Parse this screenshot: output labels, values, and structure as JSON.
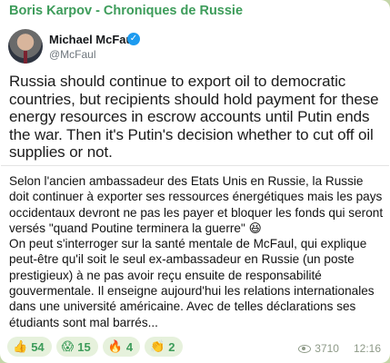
{
  "channel": {
    "name": "Boris Karpov - Chroniques de Russie"
  },
  "tweet": {
    "author": "Michael McFaul",
    "handle": "@McFaul",
    "text": "Russia should continue to export oil to democratic countries, but recipients should hold payment for these energy resources in escrow accounts until Putin ends the war. Then it's Putin's decision whether to cut off oil supplies or not."
  },
  "post": {
    "paragraph1": "Selon l'ancien ambassadeur des Etats Unis en Russie, la Russie doit continuer à exporter ses ressources énergétiques mais les pays occidentaux devront ne pas les payer et bloquer les fonds qui seront versés \"quand Poutine terminera la guerre\"",
    "paragraph1_emoji": "😆",
    "paragraph2": "On peut s'interroger sur la santé mentale de McFaul, qui explique peut-être qu'il soit le seul ex-ambassadeur en Russie (un poste prestigieux) à ne pas avoir reçu ensuite de responsabilité gouvermentale. Il enseigne aujourd'hui les relations internationales dans une université américaine. Avec de telles déclarations ses étudiants sont mal barrés..."
  },
  "reactions": [
    {
      "emoji": "👍",
      "count": "54"
    },
    {
      "emoji": "😱",
      "count": "15"
    },
    {
      "emoji": "🔥",
      "count": "4"
    },
    {
      "emoji": "👏",
      "count": "2"
    }
  ],
  "meta": {
    "views": "3710",
    "time": "12:16"
  },
  "colors": {
    "accent": "#3d9c5a",
    "background": "#c4d6a8",
    "reaction_bg": "#e6f1dc",
    "verified": "#1d9bf0"
  }
}
